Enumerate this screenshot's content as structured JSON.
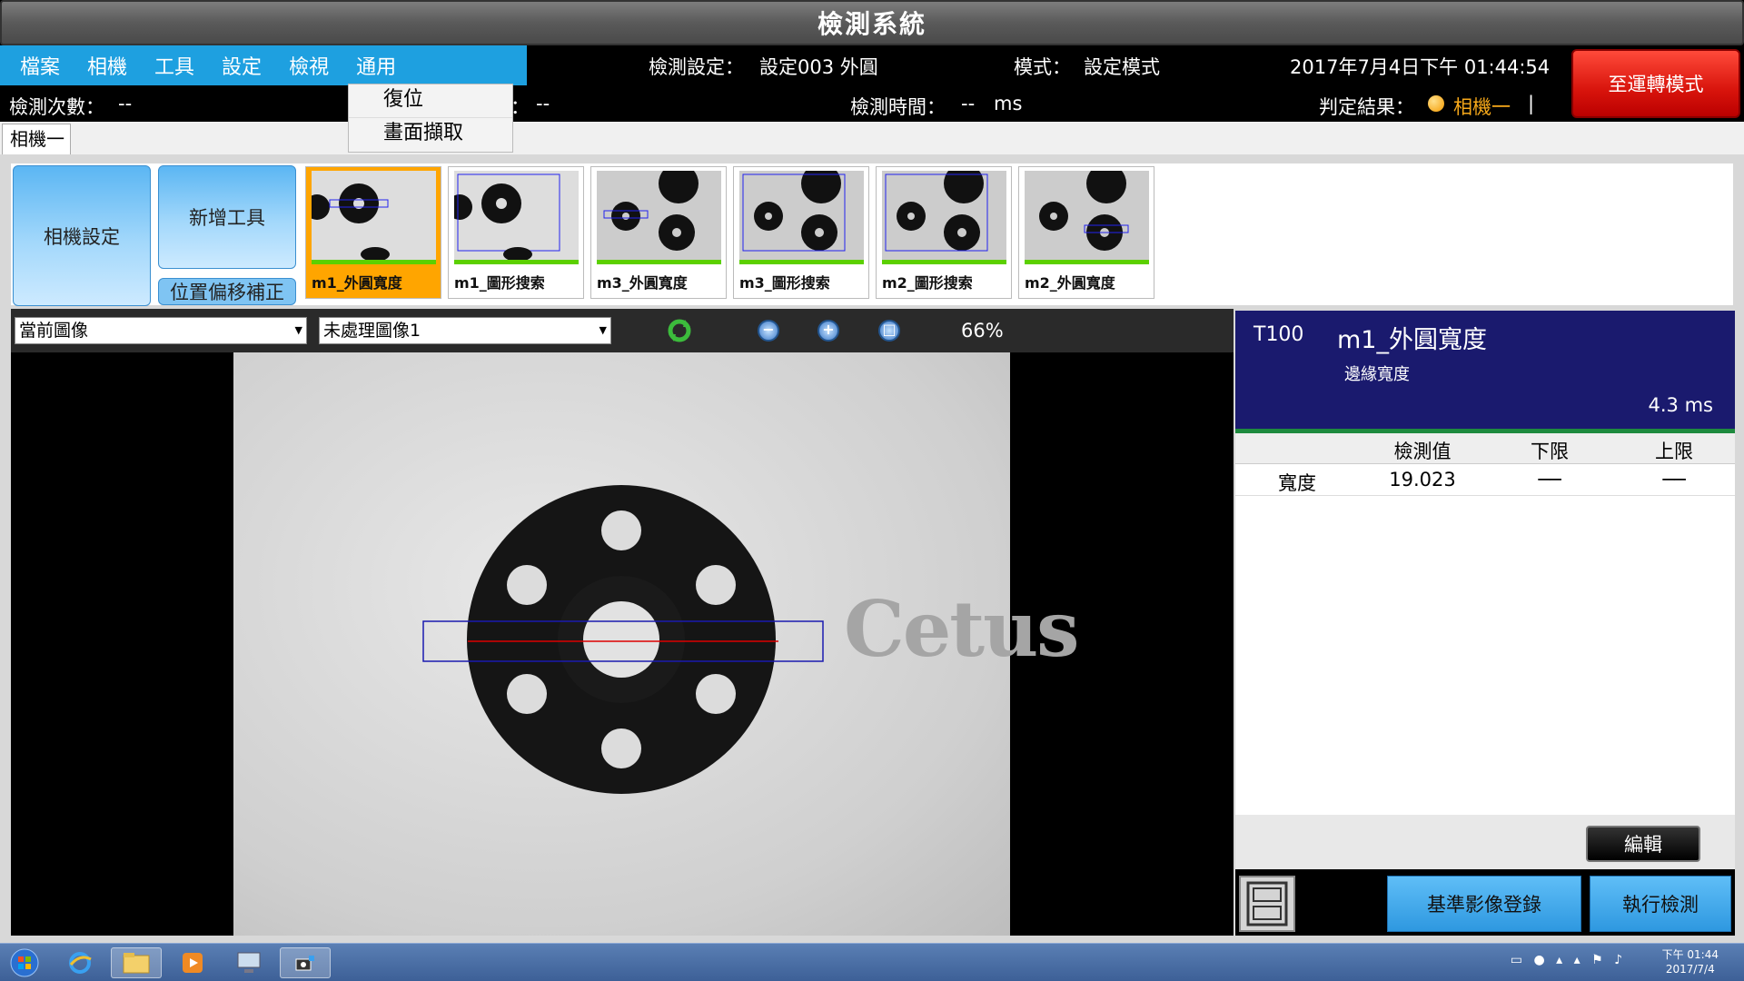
{
  "app": {
    "title": "檢測系統"
  },
  "menu": {
    "items": [
      "檔案",
      "相機",
      "工具",
      "設定",
      "檢視",
      "通用"
    ]
  },
  "dropdown": {
    "items": [
      "復位",
      "畫面擷取"
    ]
  },
  "status": {
    "setting_label": "檢測設定：",
    "setting_value": "設定003  外圓",
    "mode_label": "模式：",
    "mode_value": "設定模式",
    "datetime": "2017年7月4日下午 01:44:54",
    "count_label": "檢測次數：",
    "count_value": "--",
    "mid_label": "：",
    "mid_value": "--",
    "time_label": "檢測時間：",
    "time_value": "--",
    "time_unit": "ms",
    "result_label": "判定結果：",
    "result_camera": "相機一",
    "result_tail": "|"
  },
  "run_button": "至運轉模式",
  "tab": {
    "label": "相機一"
  },
  "buttons": {
    "camera_setting": "相機設定",
    "add_tool": "新增工具",
    "offset": "位置偏移補正"
  },
  "thumbnails": [
    {
      "label": "m1_外圓寬度",
      "active": true
    },
    {
      "label": "m1_圖形搜索",
      "active": false
    },
    {
      "label": "m3_外圓寬度",
      "active": false
    },
    {
      "label": "m3_圖形搜索",
      "active": false
    },
    {
      "label": "m2_圖形搜索",
      "active": false
    },
    {
      "label": "m2_外圓寬度",
      "active": false
    }
  ],
  "controls": {
    "image_select": "當前圖像",
    "source_select": "未處理圖像1",
    "zoom": "66%"
  },
  "watermark": "Cetus",
  "tool": {
    "id": "T100",
    "name": "m1_外圓寬度",
    "type": "邊緣寬度",
    "time": "4.3 ms"
  },
  "table": {
    "headers": [
      "",
      "檢測值",
      "下限",
      "上限"
    ],
    "rows": [
      {
        "name": "寬度",
        "value": "19.023",
        "lower": "──",
        "upper": "──"
      }
    ]
  },
  "edit_button": "編輯",
  "register_button": "基準影像登錄",
  "execute_button": "執行檢測",
  "taskbar": {
    "time": "下午 01:44",
    "date": "2017/7/4"
  },
  "colors": {
    "accent": "#1ea0e0",
    "run_red": "#d8140c",
    "active_tool": "#ffa500",
    "panel_navy": "#1a1a6e"
  }
}
